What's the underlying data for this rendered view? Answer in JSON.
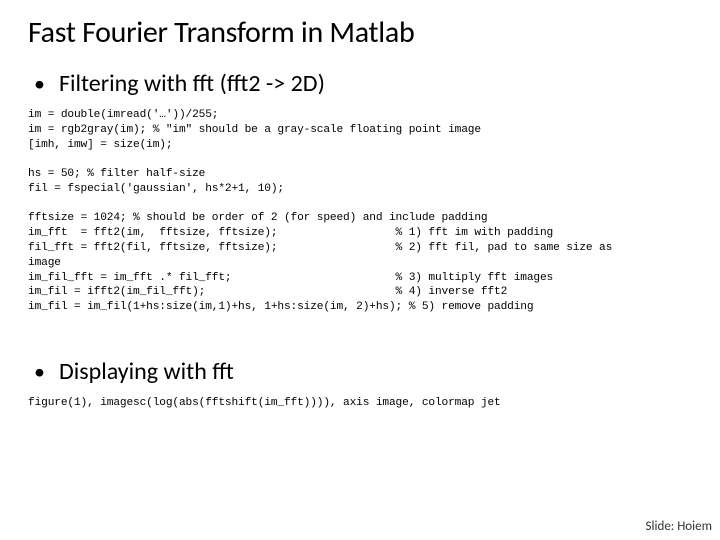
{
  "title": "Fast Fourier Transform in Matlab",
  "bullets": {
    "b1": "Filtering with fft (fft2 -> 2D)",
    "b2": "Displaying with fft"
  },
  "code1": "im = double(imread('…'))/255;\nim = rgb2gray(im); % \"im\" should be a gray-scale floating point image\n[imh, imw] = size(im);\n\nhs = 50; % filter half-size\nfil = fspecial('gaussian', hs*2+1, 10);\n\nfftsize = 1024; % should be order of 2 (for speed) and include padding\nim_fft  = fft2(im,  fftsize, fftsize);                  % 1) fft im with padding\nfil_fft = fft2(fil, fftsize, fftsize);                  % 2) fft fil, pad to same size as\nimage\nim_fil_fft = im_fft .* fil_fft;                         % 3) multiply fft images\nim_fil = ifft2(im_fil_fft);                             % 4) inverse fft2\nim_fil = im_fil(1+hs:size(im,1)+hs, 1+hs:size(im, 2)+hs); % 5) remove padding",
  "code2": "figure(1), imagesc(log(abs(fftshift(im_fft)))), axis image, colormap jet",
  "footer": "Slide: Hoiem"
}
